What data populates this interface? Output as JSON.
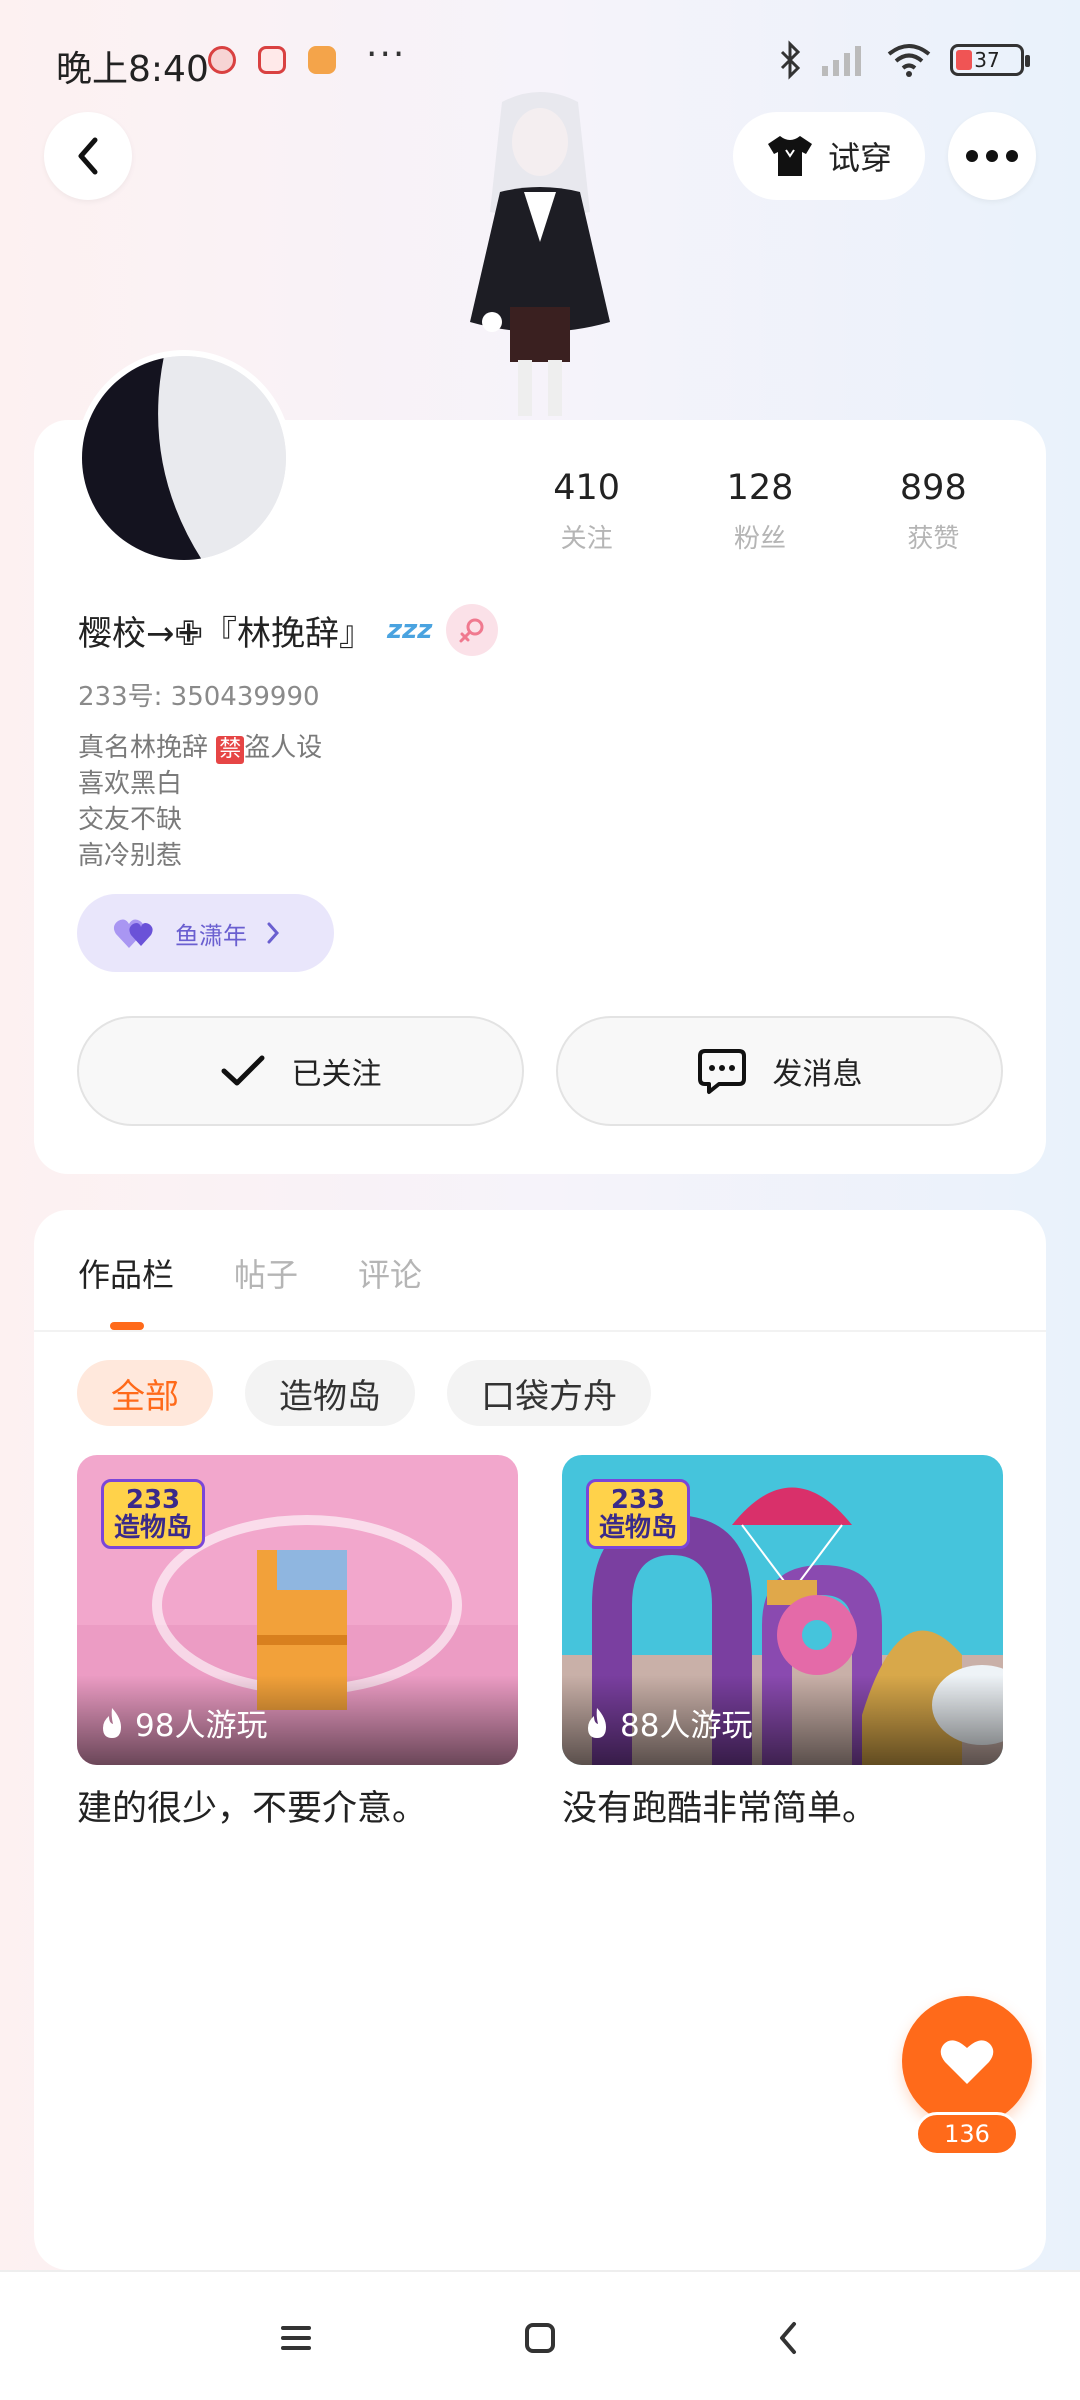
{
  "status_bar": {
    "time": "晚上8:40",
    "more_notifications": "···",
    "battery_level": "37",
    "icons": [
      "bluetooth-icon",
      "signal-icon",
      "wifi-icon",
      "battery-icon"
    ]
  },
  "header": {
    "try_on_label": "试穿"
  },
  "profile": {
    "stats": [
      {
        "value": "410",
        "label": "关注"
      },
      {
        "value": "128",
        "label": "粉丝"
      },
      {
        "value": "898",
        "label": "获赞"
      }
    ],
    "nickname": "樱校→✙『林挽辞』",
    "sleep_badge": "zzz",
    "uid": "233号: 350439990",
    "bio": {
      "line1_prefix": "真名林挽辞 ",
      "line1_badge": "禁",
      "line1_suffix": "盗人设",
      "line2": "喜欢黑白",
      "line3": "交友不缺",
      "line4": "高冷别惹"
    },
    "friend_chip_label": "鱼潇年",
    "follow_button_label": "已关注",
    "message_button_label": "发消息"
  },
  "works": {
    "tabs": [
      "作品栏",
      "帖子",
      "评论"
    ],
    "active_tab": "作品栏",
    "filters": [
      "全部",
      "造物岛",
      "口袋方舟"
    ],
    "active_filter": "全部",
    "games": [
      {
        "logo_top": "233",
        "logo_bottom": "造物岛",
        "plays": "98人游玩",
        "title": "建的很少，不要介意。"
      },
      {
        "logo_top": "233",
        "logo_bottom": "造物岛",
        "plays": "88人游玩",
        "title": "没有跑酷非常简单。"
      }
    ],
    "like_count": "136"
  },
  "colors": {
    "accent": "#ff6a1a",
    "friend_chip_bg": "#e9e6fb",
    "friend_chip_text": "#6a5fd0",
    "gender_bg": "#fbe1e8"
  }
}
